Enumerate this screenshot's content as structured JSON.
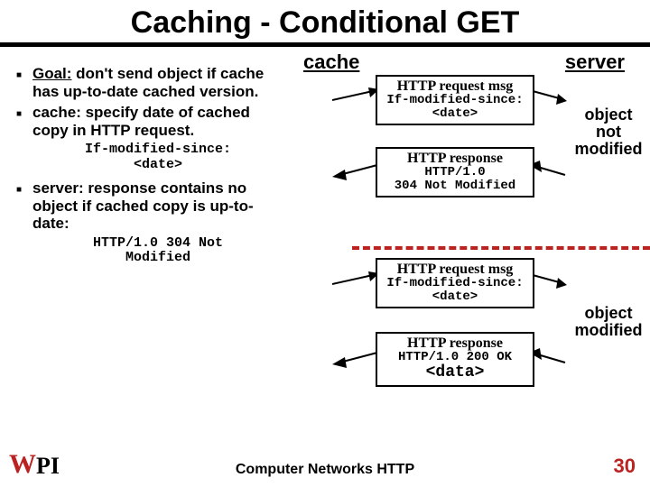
{
  "title": "Caching - Conditional GET",
  "left": {
    "bullets": [
      {
        "goal_label": "Goal:",
        "text": " don't send object if cache has up-to-date cached version."
      },
      {
        "text": "cache: specify date of cached copy in HTTP request."
      }
    ],
    "sub1_l1": "If-modified-since:",
    "sub1_l2": "<date>",
    "bullet3": "server: response contains no object if cached copy is up-to-date:",
    "sub2_l1": "HTTP/1.0 304 Not",
    "sub2_l2": "Modified"
  },
  "diagram": {
    "cache_label": "cache",
    "server_label": "server",
    "req1_title": "HTTP request msg",
    "req1_l1": "If-modified-since:",
    "req1_l2": "<date>",
    "resp1_title": "HTTP response",
    "resp1_l1": "HTTP/1.0",
    "resp1_l2": "304 Not Modified",
    "note1_l1": "object",
    "note1_l2": "not",
    "note1_l3": "modified",
    "req2_title": "HTTP request msg",
    "req2_l1": "If-modified-since:",
    "req2_l2": "<date>",
    "resp2_title": "HTTP response",
    "resp2_l1": "HTTP/1.0 200 OK",
    "resp2_data": "<data>",
    "note2_l1": "object",
    "note2_l2": "modified"
  },
  "footer": {
    "text": "Computer Networks    HTTP",
    "page": "30",
    "logo_w": "W",
    "logo_pi": "PI"
  }
}
